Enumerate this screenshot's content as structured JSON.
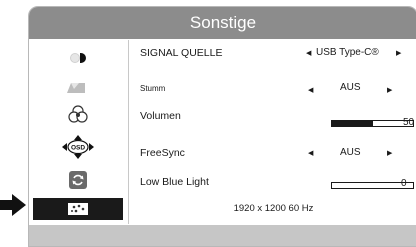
{
  "header": {
    "title": "Sonstige"
  },
  "sidebar": {
    "items": [
      {
        "icon": "brightness-icon"
      },
      {
        "icon": "image-icon"
      },
      {
        "icon": "color-icon"
      },
      {
        "icon": "osd-icon",
        "label": "OSD"
      },
      {
        "icon": "reset-icon"
      },
      {
        "icon": "misc-icon",
        "active": true
      }
    ]
  },
  "settings": {
    "signal_source": {
      "label": "SIGNAL QUELLE",
      "value": "USB Type-C®"
    },
    "mute": {
      "label": "Stumm",
      "value": "AUS"
    },
    "volume": {
      "label": "Volumen",
      "value": "50",
      "level": 0.5
    },
    "freesync": {
      "label": "FreeSync",
      "value": "AUS"
    },
    "low_blue_light": {
      "label": "Low Blue Light",
      "value": "0",
      "level": 0
    }
  },
  "status": {
    "resolution": "1920 x 1200 60 Hz"
  },
  "colors": {
    "title_bar": "#8c8c8c",
    "footer": "#c6c6c6",
    "active": "#1a1a1a"
  }
}
